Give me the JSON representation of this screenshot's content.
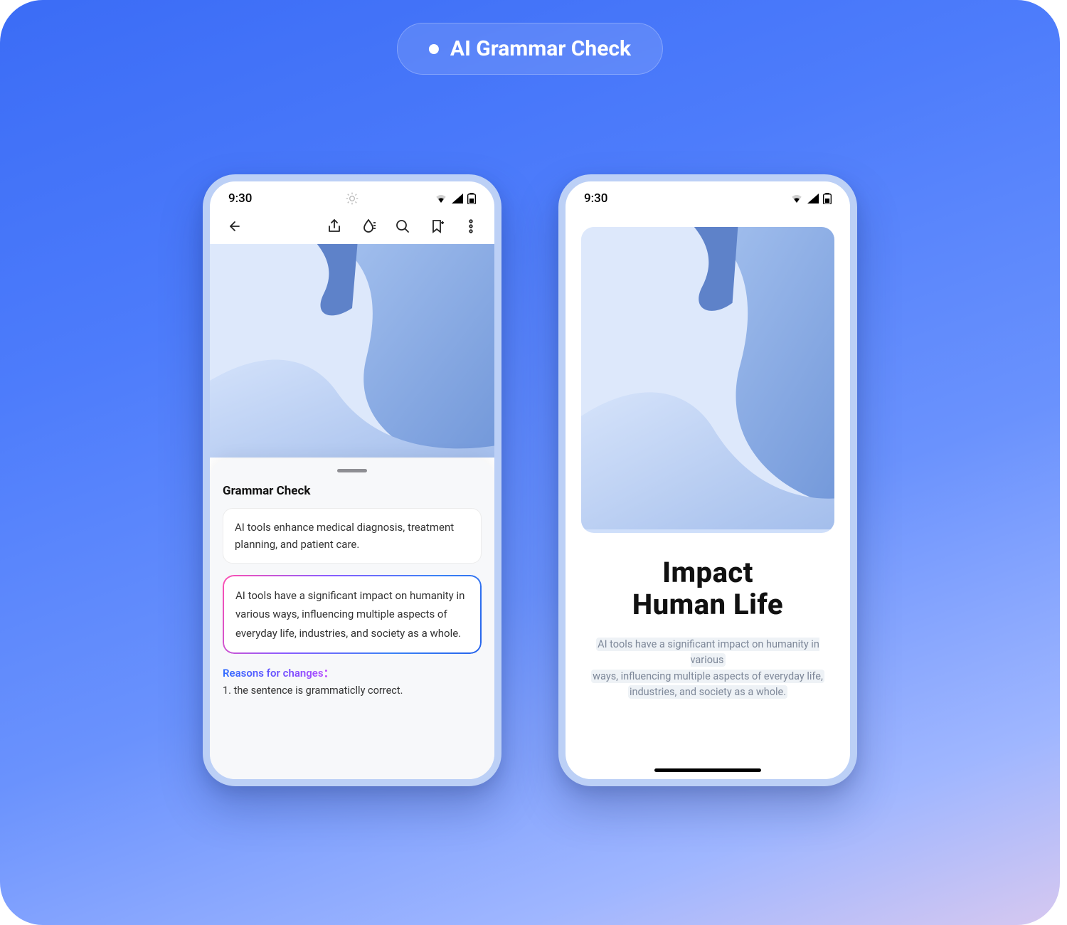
{
  "badge": {
    "label": "AI Grammar Check"
  },
  "status": {
    "time": "9:30"
  },
  "phoneA": {
    "sheet": {
      "title": "Grammar Check",
      "card1": "AI tools enhance medical diagnosis, treatment planning, and patient care.",
      "card2": "AI tools have a significant impact on humanity in various ways, influencing multiple aspects of everyday life, industries, and society as a whole.",
      "reasons_label": "Reasons for changes",
      "reasons_colon": "：",
      "reason1": "1. the sentence is grammaticlly correct."
    }
  },
  "phoneB": {
    "title_line1": "Impact",
    "title_line2": "Human Life",
    "subtitle_part1": "AI tools have a significant impact on humanity in various",
    "subtitle_part2": "ways, influencing multiple aspects of everyday life,",
    "subtitle_part3": "industries, and society as a whole."
  }
}
